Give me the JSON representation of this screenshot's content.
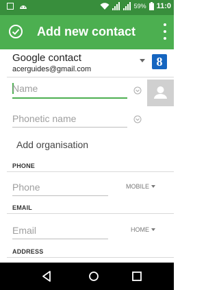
{
  "status_bar": {
    "battery_percent": "59%",
    "time": "11:0",
    "left_icons": [
      "screenshot-icon",
      "android-icon"
    ],
    "right_icons": [
      "wifi-icon",
      "signal-icon",
      "signal-icon",
      "battery-icon"
    ]
  },
  "app_bar": {
    "title": "Add new contact",
    "background": "#4CAF50",
    "status_background": "#388E3C"
  },
  "account": {
    "name": "Google contact",
    "email": "acerguides@gmail.com",
    "logo_letter": "8"
  },
  "fields": {
    "name_placeholder": "Name",
    "phonetic_placeholder": "Phonetic name",
    "add_organisation": "Add organisation",
    "phone_placeholder": "Phone",
    "email_placeholder": "Email"
  },
  "sections": {
    "phone": "PHONE",
    "email": "EMAIL",
    "address": "ADDRESS"
  },
  "types": {
    "phone_type": "MOBILE",
    "email_type": "HOME"
  },
  "nav_bar": {
    "buttons": [
      "back-icon",
      "home-icon",
      "recents-icon"
    ]
  }
}
